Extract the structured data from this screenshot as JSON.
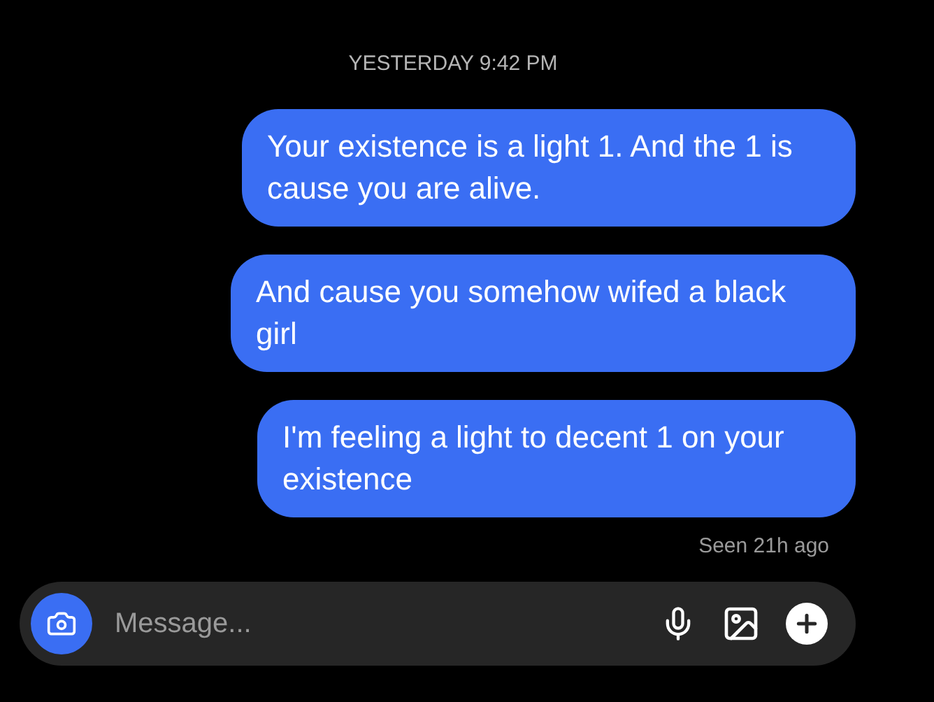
{
  "timestamp": "YESTERDAY 9:42 PM",
  "messages": [
    {
      "text": "Your existence is a light 1. And the 1 is cause you are alive."
    },
    {
      "text": "And cause you somehow wifed a black girl"
    },
    {
      "text": "I'm feeling a light to decent 1 on your existence"
    }
  ],
  "receipt": "Seen 21h ago",
  "composer": {
    "placeholder": "Message..."
  }
}
